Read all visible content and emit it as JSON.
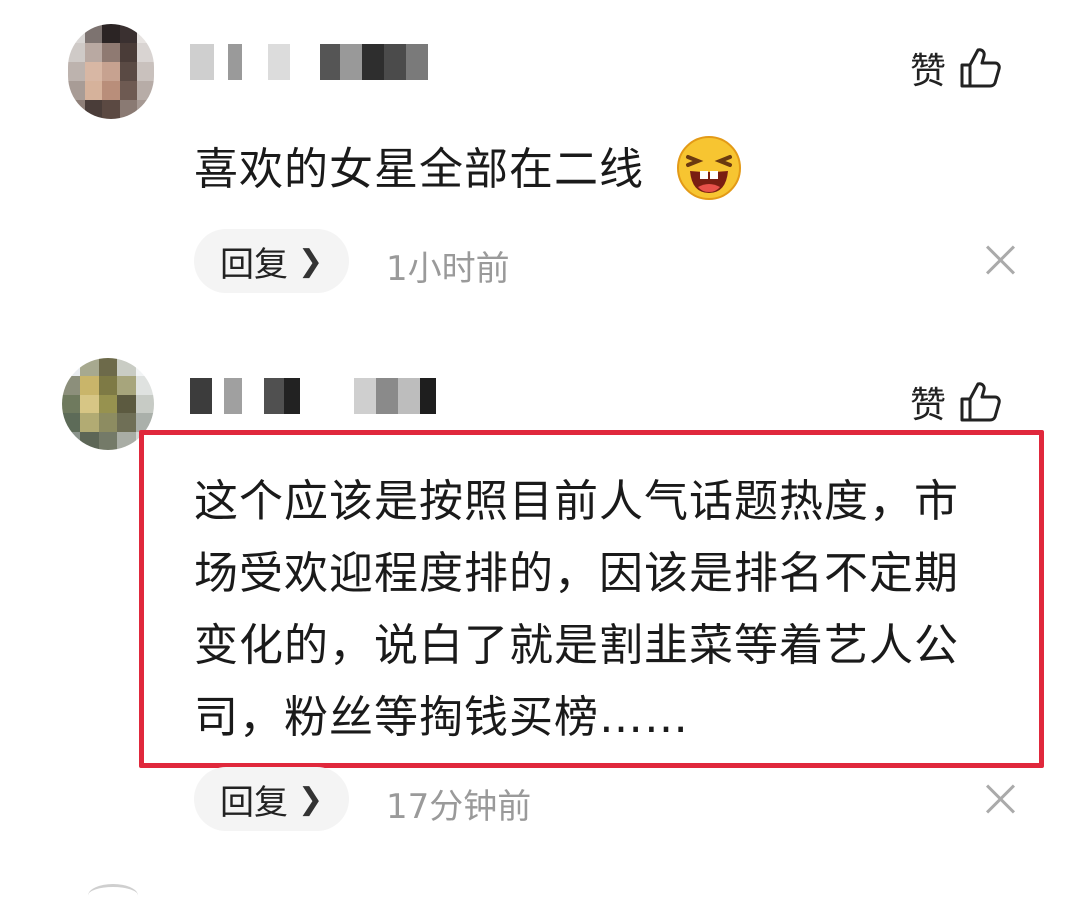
{
  "comments": [
    {
      "text_lines": [
        "喜欢的女星全部在二线"
      ],
      "like_label": "赞",
      "reply_label": "回复",
      "time": "1小时前"
    },
    {
      "text_lines": [
        "这个应该是按照目前人气话题热度，市",
        "场受欢迎程度排的，因该是排名不定期",
        "变化的，说白了就是割韭菜等着艺人公",
        "司，粉丝等掏钱买榜……"
      ],
      "like_label": "赞",
      "reply_label": "回复",
      "time": "17分钟前"
    }
  ],
  "icons": {
    "like": "thumbs-up-icon",
    "reply_chevron": "chevron-right-icon",
    "close": "close-icon",
    "emoji": "laughing-emoji-icon"
  },
  "colors": {
    "highlight_border": "#e0283c",
    "time_text": "#9a9a9a",
    "reply_bg": "#f4f4f4"
  }
}
